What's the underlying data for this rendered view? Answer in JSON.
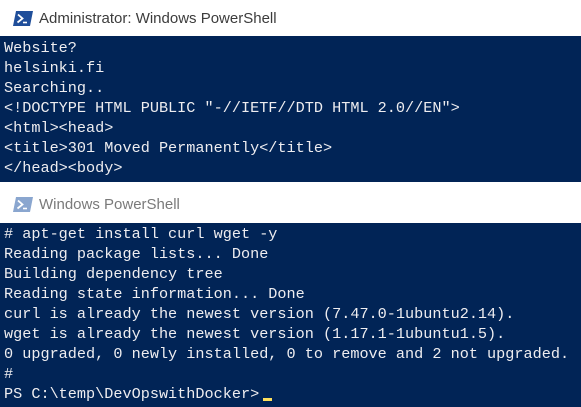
{
  "window1": {
    "title": "Administrator: Windows PowerShell",
    "icon": "powershell-icon",
    "lines": [
      "Website?",
      "helsinki.fi",
      "Searching..",
      "<!DOCTYPE HTML PUBLIC \"-//IETF//DTD HTML 2.0//EN\">",
      "<html><head>",
      "<title>301 Moved Permanently</title>",
      "</head><body>"
    ]
  },
  "window2": {
    "title": "Windows PowerShell",
    "icon": "powershell-icon",
    "lines": [
      "# apt-get install curl wget -y",
      "Reading package lists... Done",
      "Building dependency tree",
      "Reading state information... Done",
      "curl is already the newest version (7.47.0-1ubuntu2.14).",
      "wget is already the newest version (1.17.1-1ubuntu1.5).",
      "0 upgraded, 0 newly installed, 0 to remove and 2 not upgraded.",
      "#"
    ],
    "prompt": "PS C:\\temp\\DevOpswithDocker>"
  },
  "colors": {
    "console_background": "#012456",
    "console_text": "#eeedf0",
    "cursor": "#fedf5c"
  }
}
